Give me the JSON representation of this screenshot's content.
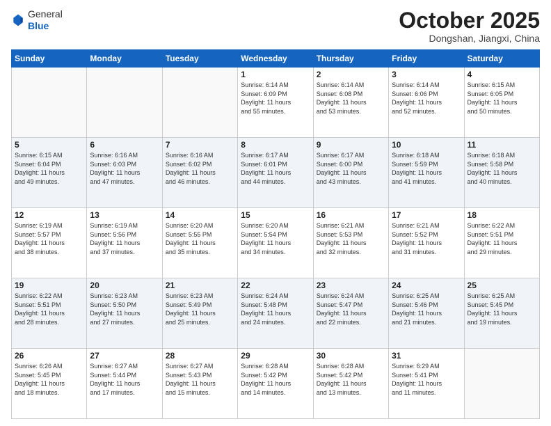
{
  "header": {
    "logo_line1": "General",
    "logo_line2": "Blue",
    "month": "October 2025",
    "location": "Dongshan, Jiangxi, China"
  },
  "weekdays": [
    "Sunday",
    "Monday",
    "Tuesday",
    "Wednesday",
    "Thursday",
    "Friday",
    "Saturday"
  ],
  "weeks": [
    {
      "shaded": false,
      "days": [
        {
          "num": "",
          "info": ""
        },
        {
          "num": "",
          "info": ""
        },
        {
          "num": "",
          "info": ""
        },
        {
          "num": "1",
          "info": "Sunrise: 6:14 AM\nSunset: 6:09 PM\nDaylight: 11 hours\nand 55 minutes."
        },
        {
          "num": "2",
          "info": "Sunrise: 6:14 AM\nSunset: 6:08 PM\nDaylight: 11 hours\nand 53 minutes."
        },
        {
          "num": "3",
          "info": "Sunrise: 6:14 AM\nSunset: 6:06 PM\nDaylight: 11 hours\nand 52 minutes."
        },
        {
          "num": "4",
          "info": "Sunrise: 6:15 AM\nSunset: 6:05 PM\nDaylight: 11 hours\nand 50 minutes."
        }
      ]
    },
    {
      "shaded": true,
      "days": [
        {
          "num": "5",
          "info": "Sunrise: 6:15 AM\nSunset: 6:04 PM\nDaylight: 11 hours\nand 49 minutes."
        },
        {
          "num": "6",
          "info": "Sunrise: 6:16 AM\nSunset: 6:03 PM\nDaylight: 11 hours\nand 47 minutes."
        },
        {
          "num": "7",
          "info": "Sunrise: 6:16 AM\nSunset: 6:02 PM\nDaylight: 11 hours\nand 46 minutes."
        },
        {
          "num": "8",
          "info": "Sunrise: 6:17 AM\nSunset: 6:01 PM\nDaylight: 11 hours\nand 44 minutes."
        },
        {
          "num": "9",
          "info": "Sunrise: 6:17 AM\nSunset: 6:00 PM\nDaylight: 11 hours\nand 43 minutes."
        },
        {
          "num": "10",
          "info": "Sunrise: 6:18 AM\nSunset: 5:59 PM\nDaylight: 11 hours\nand 41 minutes."
        },
        {
          "num": "11",
          "info": "Sunrise: 6:18 AM\nSunset: 5:58 PM\nDaylight: 11 hours\nand 40 minutes."
        }
      ]
    },
    {
      "shaded": false,
      "days": [
        {
          "num": "12",
          "info": "Sunrise: 6:19 AM\nSunset: 5:57 PM\nDaylight: 11 hours\nand 38 minutes."
        },
        {
          "num": "13",
          "info": "Sunrise: 6:19 AM\nSunset: 5:56 PM\nDaylight: 11 hours\nand 37 minutes."
        },
        {
          "num": "14",
          "info": "Sunrise: 6:20 AM\nSunset: 5:55 PM\nDaylight: 11 hours\nand 35 minutes."
        },
        {
          "num": "15",
          "info": "Sunrise: 6:20 AM\nSunset: 5:54 PM\nDaylight: 11 hours\nand 34 minutes."
        },
        {
          "num": "16",
          "info": "Sunrise: 6:21 AM\nSunset: 5:53 PM\nDaylight: 11 hours\nand 32 minutes."
        },
        {
          "num": "17",
          "info": "Sunrise: 6:21 AM\nSunset: 5:52 PM\nDaylight: 11 hours\nand 31 minutes."
        },
        {
          "num": "18",
          "info": "Sunrise: 6:22 AM\nSunset: 5:51 PM\nDaylight: 11 hours\nand 29 minutes."
        }
      ]
    },
    {
      "shaded": true,
      "days": [
        {
          "num": "19",
          "info": "Sunrise: 6:22 AM\nSunset: 5:51 PM\nDaylight: 11 hours\nand 28 minutes."
        },
        {
          "num": "20",
          "info": "Sunrise: 6:23 AM\nSunset: 5:50 PM\nDaylight: 11 hours\nand 27 minutes."
        },
        {
          "num": "21",
          "info": "Sunrise: 6:23 AM\nSunset: 5:49 PM\nDaylight: 11 hours\nand 25 minutes."
        },
        {
          "num": "22",
          "info": "Sunrise: 6:24 AM\nSunset: 5:48 PM\nDaylight: 11 hours\nand 24 minutes."
        },
        {
          "num": "23",
          "info": "Sunrise: 6:24 AM\nSunset: 5:47 PM\nDaylight: 11 hours\nand 22 minutes."
        },
        {
          "num": "24",
          "info": "Sunrise: 6:25 AM\nSunset: 5:46 PM\nDaylight: 11 hours\nand 21 minutes."
        },
        {
          "num": "25",
          "info": "Sunrise: 6:25 AM\nSunset: 5:45 PM\nDaylight: 11 hours\nand 19 minutes."
        }
      ]
    },
    {
      "shaded": false,
      "days": [
        {
          "num": "26",
          "info": "Sunrise: 6:26 AM\nSunset: 5:45 PM\nDaylight: 11 hours\nand 18 minutes."
        },
        {
          "num": "27",
          "info": "Sunrise: 6:27 AM\nSunset: 5:44 PM\nDaylight: 11 hours\nand 17 minutes."
        },
        {
          "num": "28",
          "info": "Sunrise: 6:27 AM\nSunset: 5:43 PM\nDaylight: 11 hours\nand 15 minutes."
        },
        {
          "num": "29",
          "info": "Sunrise: 6:28 AM\nSunset: 5:42 PM\nDaylight: 11 hours\nand 14 minutes."
        },
        {
          "num": "30",
          "info": "Sunrise: 6:28 AM\nSunset: 5:42 PM\nDaylight: 11 hours\nand 13 minutes."
        },
        {
          "num": "31",
          "info": "Sunrise: 6:29 AM\nSunset: 5:41 PM\nDaylight: 11 hours\nand 11 minutes."
        },
        {
          "num": "",
          "info": ""
        }
      ]
    }
  ]
}
